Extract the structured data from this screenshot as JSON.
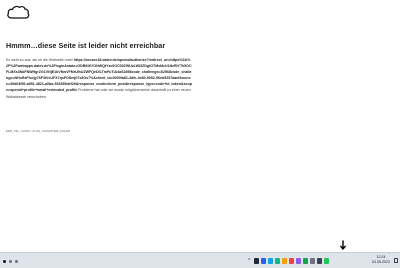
{
  "error_page": {
    "heading": "Hmmm…diese Seite ist leider nicht erreichbar",
    "message_intro": "Es sieht so aus, als ob die Webseite unter ",
    "url": "https://secure18.datev.de/openid/authorize?redirect_uri=https%3A%2F%2Fwebapps.datev.de%2Flogin&state=ODBiNGY2NWQtYzc0OC00ZWUzLWI3ZDgtOTMxMzU1NzRlYTk5OCFLMXs3NkFNWHgrZG1VNjE1bVNwVFMrUlhUZWFQeDlLTmFuTlA4aS2898code_challenge=S2568code_challenge=NHoRzFfuxjy76F3iVcUFX7qxFOSmj07s5Os7%&client_id=0000fa81-3dfc-4e80-9052-96eb5257aaef&nonce=39d63f56-a951-4821-a0ba-933355def26&response_mode=form_post&response_type=code+id_token&scope=openid+profile+email+extended_profile",
    "message_outro": " Probleme hat oder sie wurde möglicherweise dauerhaft zu einer neuen Webadresse verschoben.",
    "error_code": "ERR_SSL_CLIENT_AUTH_SIGNATURE_FAILED"
  },
  "taskbar": {
    "clock_time": "12:24",
    "clock_date": "03.05.2023"
  },
  "icons": {
    "page_icon": "cloud-icon",
    "cursor": "mouse-cursor-icon"
  },
  "colors": {
    "page_bg": "#ffffff",
    "taskbar_bg": "#dfe3ea",
    "tray": [
      "#1f2937",
      "#2563eb",
      "#0ea5e9",
      "#10b981",
      "#f59e0b",
      "#ef4444",
      "#8b5cf6",
      "#16a34a",
      "#6b7280",
      "#374151",
      "#22c55e"
    ]
  }
}
